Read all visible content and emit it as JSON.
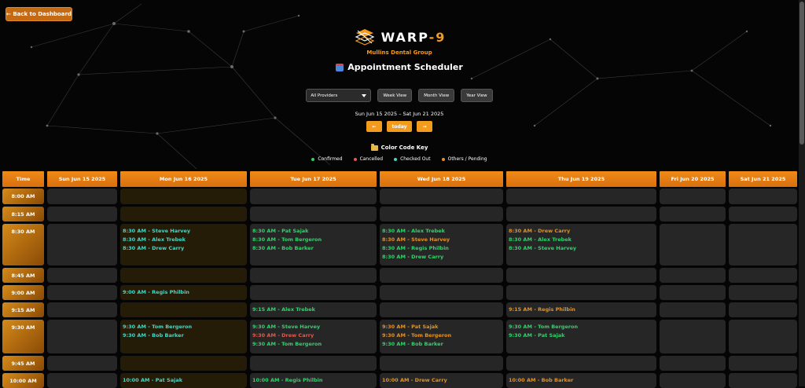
{
  "back_button": {
    "label": "← Back to Dashboard"
  },
  "brand": {
    "name_a": "WARP",
    "name_b": "-9",
    "clinic": "Mullins Dental Group"
  },
  "title": "Appointment Scheduler",
  "controls": {
    "provider_select": "All Providers",
    "views": [
      "Week View",
      "Month View",
      "Year View"
    ]
  },
  "range": "Sun Jun 15 2025 – Sat Jun 21 2025",
  "nav": {
    "prev": "←",
    "today": "today",
    "next": "→"
  },
  "color_key": {
    "title": "Color Code Key",
    "items": [
      {
        "label": "Confirmed",
        "color": "#2fd36a"
      },
      {
        "label": "Cancelled",
        "color": "#e25a4a"
      },
      {
        "label": "Checked Out",
        "color": "#46d6c8"
      },
      {
        "label": "Others / Pending",
        "color": "#e0922a"
      }
    ]
  },
  "schedule": {
    "time_header": "Time",
    "days": [
      "Sun Jun 15 2025",
      "Mon Jun 16 2025",
      "Tue Jun 17 2025",
      "Wed Jun 18 2025",
      "Thu Jun 19 2025",
      "Fri Jun 20 2025",
      "Sat Jun 21 2025"
    ],
    "rows": [
      {
        "time": "8:00 AM",
        "cells": [
          [],
          [],
          [],
          [],
          [],
          [],
          []
        ]
      },
      {
        "time": "8:15 AM",
        "cells": [
          [],
          [],
          [],
          [],
          [],
          [],
          []
        ]
      },
      {
        "time": "8:30 AM",
        "cells": [
          [],
          [
            {
              "text": "8:30 AM - Steve Harvey",
              "status": "checked"
            },
            {
              "text": "8:30 AM - Alex Trebek",
              "status": "checked"
            },
            {
              "text": "8:30 AM - Drew Carry",
              "status": "checked"
            }
          ],
          [
            {
              "text": "8:30 AM - Pat Sajak",
              "status": "confirmed"
            },
            {
              "text": "8:30 AM - Tom Bergeron",
              "status": "confirmed"
            },
            {
              "text": "8:30 AM - Bob Barker",
              "status": "confirmed"
            }
          ],
          [
            {
              "text": "8:30 AM - Alex Trebek",
              "status": "confirmed"
            },
            {
              "text": "8:30 AM - Steve Harvey",
              "status": "other"
            },
            {
              "text": "8:30 AM - Regis Philbin",
              "status": "confirmed"
            },
            {
              "text": "8:30 AM - Drew Carry",
              "status": "confirmed"
            }
          ],
          [
            {
              "text": "8:30 AM - Drew Carry",
              "status": "other"
            },
            {
              "text": "8:30 AM - Alex Trebek",
              "status": "confirmed"
            },
            {
              "text": "8:30 AM - Steve Harvey",
              "status": "confirmed"
            }
          ],
          [],
          []
        ]
      },
      {
        "time": "8:45 AM",
        "cells": [
          [],
          [],
          [],
          [],
          [],
          [],
          []
        ]
      },
      {
        "time": "9:00 AM",
        "cells": [
          [],
          [
            {
              "text": "9:00 AM - Regis Philbin",
              "status": "checked"
            }
          ],
          [],
          [],
          [],
          [],
          []
        ]
      },
      {
        "time": "9:15 AM",
        "cells": [
          [],
          [],
          [
            {
              "text": "9:15 AM - Alex Trebek",
              "status": "confirmed"
            }
          ],
          [],
          [
            {
              "text": "9:15 AM - Regis Philbin",
              "status": "other"
            }
          ],
          [],
          []
        ]
      },
      {
        "time": "9:30 AM",
        "cells": [
          [],
          [
            {
              "text": "9:30 AM - Tom Bergeron",
              "status": "checked"
            },
            {
              "text": "9:30 AM - Bob Barker",
              "status": "checked"
            }
          ],
          [
            {
              "text": "9:30 AM - Steve Harvey",
              "status": "confirmed"
            },
            {
              "text": "9:30 AM - Drew Carry",
              "status": "cancelled"
            },
            {
              "text": "9:30 AM - Tom Bergeron",
              "status": "confirmed"
            }
          ],
          [
            {
              "text": "9:30 AM - Pat Sajak",
              "status": "other"
            },
            {
              "text": "9:30 AM - Tom Bergeron",
              "status": "other"
            },
            {
              "text": "9:30 AM - Bob Barker",
              "status": "confirmed"
            }
          ],
          [
            {
              "text": "9:30 AM - Tom Bergeron",
              "status": "confirmed"
            },
            {
              "text": "9:30 AM - Pat Sajak",
              "status": "confirmed"
            }
          ],
          [],
          []
        ]
      },
      {
        "time": "9:45 AM",
        "cells": [
          [],
          [],
          [],
          [],
          [],
          [],
          []
        ]
      },
      {
        "time": "10:00 AM",
        "cells": [
          [],
          [
            {
              "text": "10:00 AM - Pat Sajak",
              "status": "checked"
            }
          ],
          [
            {
              "text": "10:00 AM - Regis Philbin",
              "status": "confirmed"
            }
          ],
          [
            {
              "text": "10:00 AM - Drew Carry",
              "status": "other"
            }
          ],
          [
            {
              "text": "10:00 AM - Bob Barker",
              "status": "other"
            }
          ],
          [],
          []
        ]
      }
    ]
  }
}
